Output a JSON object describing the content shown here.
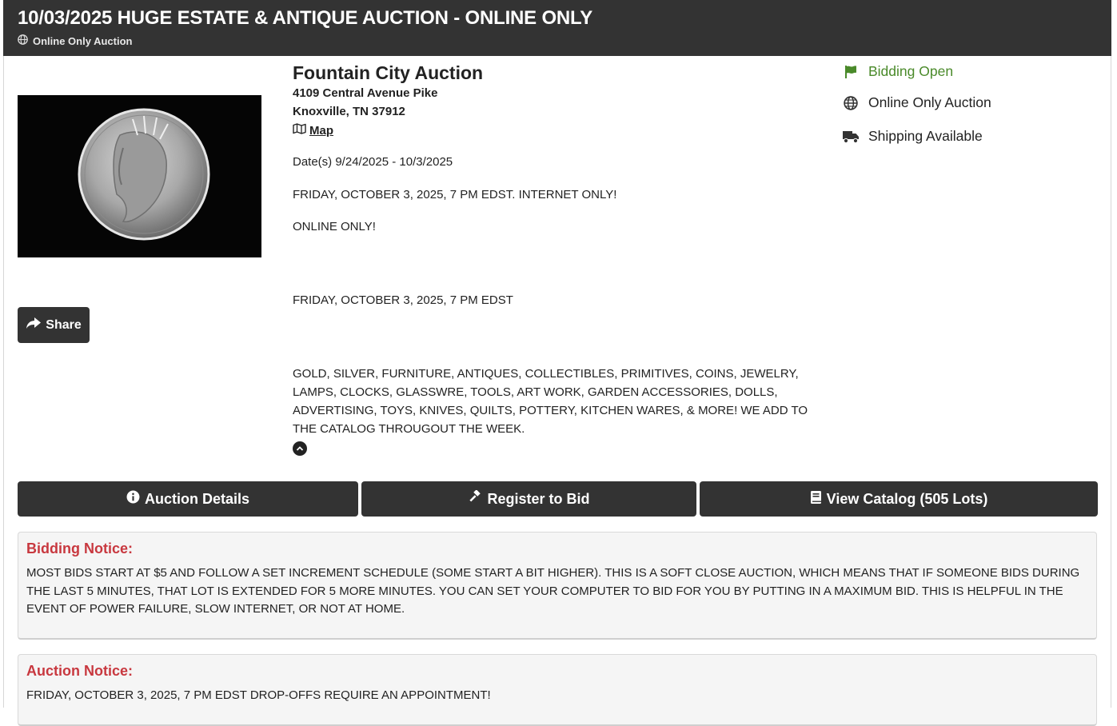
{
  "header": {
    "title": "10/03/2025 HUGE ESTATE & ANTIQUE AUCTION - ONLINE ONLY",
    "subtitle": "Online Only Auction"
  },
  "company": {
    "name": "Fountain City Auction",
    "address_line1": "4109 Central Avenue Pike",
    "address_line2": "Knoxville, TN 37912",
    "map_label": "Map"
  },
  "dates": "Date(s) 9/24/2025 - 10/3/2025",
  "description": {
    "line1": "FRIDAY, OCTOBER 3, 2025, 7 PM EDST. INTERNET ONLY!",
    "line2": "ONLINE ONLY!",
    "line3": "FRIDAY, OCTOBER 3, 2025, 7 PM EDST",
    "items": "GOLD, SILVER, FURNITURE, ANTIQUES, COLLECTIBLES, PRIMITIVES, COINS, JEWELRY, LAMPS, CLOCKS, GLASSWRE, TOOLS, ART WORK, GARDEN ACCESSORIES, DOLLS, ADVERTISING, TOYS, KNIVES, QUILTS, POTTERY, KITCHEN WARES, & MORE! WE ADD TO THE CATALOG THROUGOUT THE WEEK."
  },
  "status": {
    "bidding": "Bidding Open",
    "type": "Online Only Auction",
    "shipping": "Shipping Available",
    "bidding_color": "#4a8a2a"
  },
  "buttons": {
    "share": "Share",
    "details": "Auction Details",
    "register": "Register to Bid",
    "catalog": "View Catalog (505 Lots)"
  },
  "notices": {
    "bidding_title": "Bidding Notice:",
    "bidding_body": "MOST BIDS START AT $5 AND FOLLOW A SET INCREMENT SCHEDULE (SOME START A BIT HIGHER). THIS IS A SOFT CLOSE AUCTION, WHICH MEANS THAT IF SOMEONE BIDS DURING THE LAST 5 MINUTES, THAT LOT IS EXTENDED FOR 5 MORE MINUTES. YOU CAN SET YOUR COMPUTER TO BID FOR YOU BY PUTTING IN A MAXIMUM BID. THIS IS HELPFUL IN THE EVENT OF POWER FAILURE, SLOW INTERNET, OR NOT AT HOME.",
    "auction_title": "Auction Notice:",
    "auction_body": "FRIDAY, OCTOBER 3, 2025, 7 PM EDST DROP-OFFS REQUIRE AN APPOINTMENT!"
  }
}
